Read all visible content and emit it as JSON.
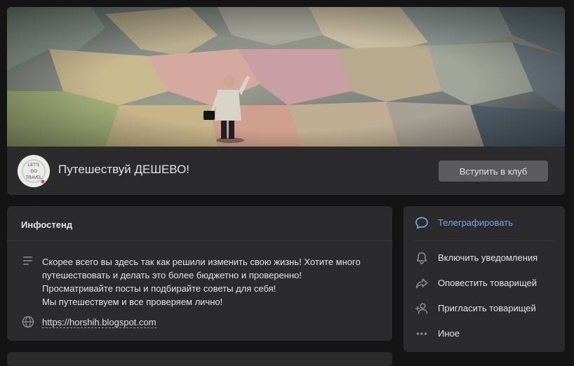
{
  "group": {
    "title": "Путешествуй ДЕШЕВО!",
    "join_label": "Вступить в клуб",
    "avatar_text": [
      "LET'S",
      "GO",
      "TRAVEL"
    ]
  },
  "info": {
    "title": "Инфостенд",
    "description_lines": [
      "Скорее всего вы здесь так как решили изменить свою жизнь! Хотите много",
      "путешествовать и делать это более бюджетно и проверенно!",
      "Просматривайте посты и подбирайте советы для себя!",
      "Мы путешествуем и все проверяем лично!"
    ],
    "website": "https://horshih.blogspot.com"
  },
  "actions": [
    {
      "label": "Телеграфировать",
      "icon": "message-bubble-icon"
    },
    {
      "label": "Включить уведомления",
      "icon": "bell-icon"
    },
    {
      "label": "Оповестить товарищей",
      "icon": "share-arrow-icon"
    },
    {
      "label": "Пригласить товарищей",
      "icon": "add-user-icon"
    },
    {
      "label": "Иное",
      "icon": "more-dots-icon"
    }
  ],
  "colors": {
    "page_bg": "#141414",
    "card_bg": "#2b2b2d",
    "accent": "#71aaeb",
    "text": "#e1e3e6",
    "button_bg": "#5b5b5e"
  }
}
